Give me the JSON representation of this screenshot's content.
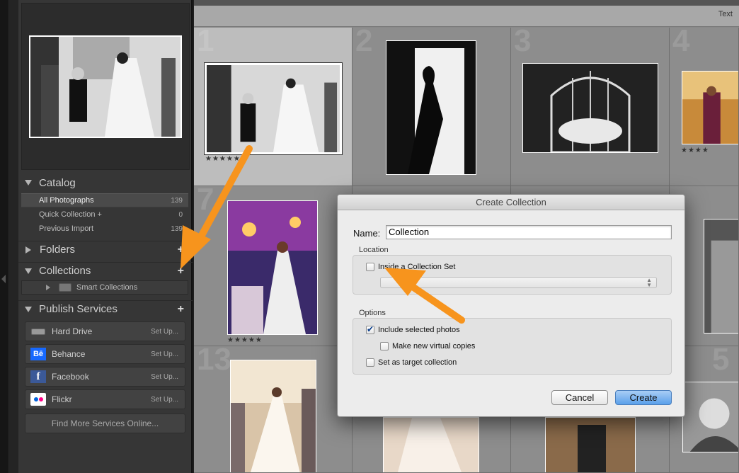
{
  "catalog": {
    "title": "Catalog",
    "items": [
      {
        "label": "All Photographs",
        "count": "139"
      },
      {
        "label": "Quick Collection  +",
        "count": "0"
      },
      {
        "label": "Previous Import",
        "count": "139"
      }
    ]
  },
  "folders": {
    "title": "Folders",
    "plus": "+"
  },
  "collections": {
    "title": "Collections",
    "plus": "+",
    "smart": "Smart Collections"
  },
  "publish": {
    "title": "Publish Services",
    "plus": "+",
    "services": [
      {
        "label": "Hard Drive",
        "setup": "Set Up...",
        "icon": "hard-drive-icon"
      },
      {
        "label": "Behance",
        "setup": "Set Up...",
        "icon": "behance-icon",
        "glyph": "Bē"
      },
      {
        "label": "Facebook",
        "setup": "Set Up...",
        "icon": "facebook-icon",
        "glyph": "f"
      },
      {
        "label": "Flickr",
        "setup": "Set Up...",
        "icon": "flickr-icon"
      }
    ],
    "find_more": "Find More Services Online..."
  },
  "toolbar": {
    "text": "Text"
  },
  "grid": {
    "cells": [
      {
        "num": "1",
        "stars": "★★★★★"
      },
      {
        "num": "2",
        "stars": ""
      },
      {
        "num": "3",
        "stars": ""
      },
      {
        "num": "4",
        "stars": "★★★★"
      },
      {
        "num": "7",
        "stars": "★★★★★"
      },
      {
        "num": "13",
        "stars": ""
      },
      {
        "num": "5",
        "stars": ""
      }
    ]
  },
  "dialog": {
    "title": "Create Collection",
    "name_label": "Name:",
    "name_value": "Collection",
    "location_label": "Location",
    "inside_set_label": "Inside a Collection Set",
    "inside_set_checked": false,
    "options_label": "Options",
    "include_selected_label": "Include selected photos",
    "include_selected_checked": true,
    "virtual_copies_label": "Make new virtual copies",
    "virtual_copies_checked": false,
    "target_label": "Set as target collection",
    "target_checked": false,
    "cancel_label": "Cancel",
    "create_label": "Create"
  },
  "colors": {
    "annotation_arrow": "#f7941d",
    "primary_button": "#5aa0ea",
    "panel_bg": "#363636"
  }
}
